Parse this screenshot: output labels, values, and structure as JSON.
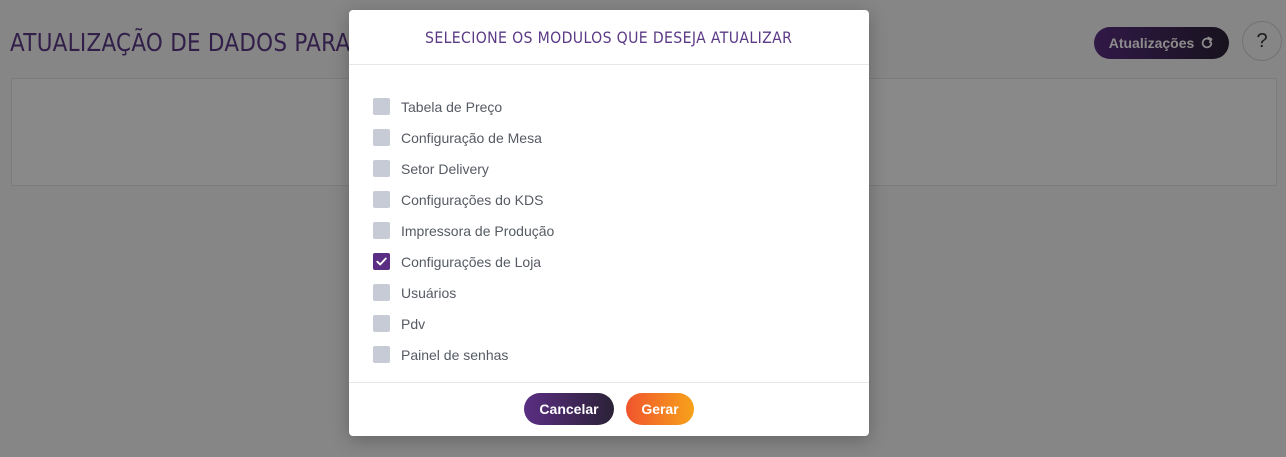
{
  "header": {
    "page_title": "ATUALIZAÇÃO DE DADOS PARA",
    "updates_label": "Atualizações",
    "help_label": "?"
  },
  "modal": {
    "title": "SELECIONE OS MODULOS QUE DESEJA ATUALIZAR",
    "options": [
      {
        "label": "Tabela de Preço",
        "checked": false
      },
      {
        "label": "Configuração de Mesa",
        "checked": false
      },
      {
        "label": "Setor Delivery",
        "checked": false
      },
      {
        "label": "Configurações do KDS",
        "checked": false
      },
      {
        "label": "Impressora de Produção",
        "checked": false
      },
      {
        "label": "Configurações de Loja",
        "checked": true
      },
      {
        "label": "Usuários",
        "checked": false
      },
      {
        "label": "Pdv",
        "checked": false
      },
      {
        "label": "Painel de senhas",
        "checked": false
      }
    ],
    "cancel_label": "Cancelar",
    "generate_label": "Gerar"
  },
  "colors": {
    "brand_purple": "#5a2e82",
    "brand_dark": "#2b2237",
    "accent_orange": "#f0542d",
    "accent_yellow": "#f7a21b",
    "checkbox_unchecked": "#c7cbd6"
  },
  "icons": {
    "updates": "refresh-icon",
    "checked": "check-icon"
  }
}
